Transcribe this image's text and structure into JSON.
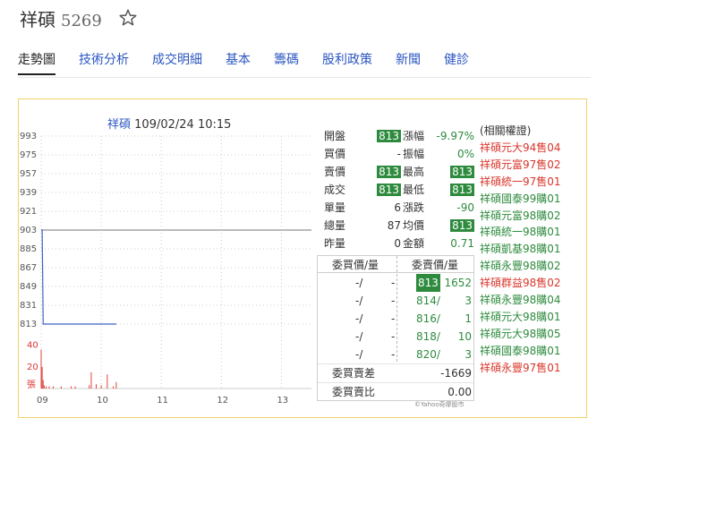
{
  "header": {
    "name": "祥碩",
    "code": "5269",
    "star_icon": "star-outline-icon"
  },
  "tabs": [
    {
      "label": "走勢圖",
      "active": true
    },
    {
      "label": "技術分析",
      "active": false
    },
    {
      "label": "成交明細",
      "active": false
    },
    {
      "label": "基本",
      "active": false
    },
    {
      "label": "籌碼",
      "active": false
    },
    {
      "label": "股利政策",
      "active": false
    },
    {
      "label": "新聞",
      "active": false
    },
    {
      "label": "健診",
      "active": false
    }
  ],
  "chart": {
    "name": "祥碩",
    "datetime": "109/02/24 10:15",
    "colors": {
      "price_line": "#3a62c8",
      "reference_line": "#bbbbbb",
      "volume": "#e0403a",
      "grid": "#cccccc"
    }
  },
  "chart_data": {
    "type": "line",
    "x_ticks": [
      "09",
      "10",
      "11",
      "12",
      "13"
    ],
    "y_ticks": [
      993,
      975,
      957,
      939,
      921,
      903,
      885,
      867,
      849,
      831,
      813
    ],
    "ylim": [
      813,
      993
    ],
    "reference_price": 903,
    "series": [
      {
        "x": [
          "09:00",
          "09:01",
          "09:02",
          "10:15"
        ],
        "values": [
          903,
          903,
          813,
          813
        ]
      }
    ],
    "volume": {
      "ticks": [
        40,
        20
      ],
      "label": "張",
      "bars": [
        {
          "t": "09:00",
          "v": 36
        },
        {
          "t": "09:01",
          "v": 20
        },
        {
          "t": "09:02",
          "v": 8
        },
        {
          "t": "09:03",
          "v": 3
        },
        {
          "t": "09:05",
          "v": 2
        },
        {
          "t": "09:08",
          "v": 2
        },
        {
          "t": "09:12",
          "v": 2
        },
        {
          "t": "09:20",
          "v": 2
        },
        {
          "t": "09:30",
          "v": 2
        },
        {
          "t": "09:34",
          "v": 2
        },
        {
          "t": "09:48",
          "v": 3
        },
        {
          "t": "09:50",
          "v": 15
        },
        {
          "t": "09:55",
          "v": 4
        },
        {
          "t": "10:00",
          "v": 3
        },
        {
          "t": "10:06",
          "v": 13
        },
        {
          "t": "10:12",
          "v": 2
        },
        {
          "t": "10:15",
          "v": 6
        }
      ]
    }
  },
  "quote": {
    "left": [
      {
        "label": "開盤",
        "value": "813",
        "highlight": true
      },
      {
        "label": "買價",
        "value": "-",
        "highlight": false
      },
      {
        "label": "賣價",
        "value": "813",
        "highlight": true
      },
      {
        "label": "成交",
        "value": "813",
        "highlight": true
      },
      {
        "label": "單量",
        "value": "6",
        "highlight": false
      },
      {
        "label": "總量",
        "value": "87",
        "highlight": false
      },
      {
        "label": "昨量",
        "value": "0",
        "highlight": false
      }
    ],
    "right": [
      {
        "label": "漲幅",
        "value": "-9.97%",
        "highlight": false,
        "green": true
      },
      {
        "label": "振幅",
        "value": "0%",
        "highlight": false,
        "green": true
      },
      {
        "label": "最高",
        "value": "813",
        "highlight": true,
        "green": false
      },
      {
        "label": "最低",
        "value": "813",
        "highlight": true,
        "green": false
      },
      {
        "label": "漲跌",
        "value": "-90",
        "highlight": false,
        "green": true
      },
      {
        "label": "均價",
        "value": "813",
        "highlight": true,
        "green": false
      },
      {
        "label": "金額",
        "value": "0.71",
        "highlight": false,
        "green": true
      }
    ]
  },
  "orderbook": {
    "bid_header": "委買價/量",
    "ask_header": "委賣價/量",
    "rows": [
      {
        "bid_price": "-/",
        "bid_qty": "-",
        "ask_price": "813",
        "ask_qty": "1652",
        "ask_highlight": true
      },
      {
        "bid_price": "-/",
        "bid_qty": "-",
        "ask_price": "814/",
        "ask_qty": "3",
        "ask_highlight": false
      },
      {
        "bid_price": "-/",
        "bid_qty": "-",
        "ask_price": "816/",
        "ask_qty": "1",
        "ask_highlight": false
      },
      {
        "bid_price": "-/",
        "bid_qty": "-",
        "ask_price": "818/",
        "ask_qty": "10",
        "ask_highlight": false
      },
      {
        "bid_price": "-/",
        "bid_qty": "-",
        "ask_price": "820/",
        "ask_qty": "3",
        "ask_highlight": false
      }
    ],
    "summary": [
      {
        "label": "委買賣差",
        "value": "-1669"
      },
      {
        "label": "委買賣比",
        "value": "0.00"
      }
    ],
    "credit": "©Yahoo奇摩股市"
  },
  "warrants": {
    "heading": "(相關權證)",
    "items": [
      {
        "label": "祥碩元大94售04",
        "kind": "sell"
      },
      {
        "label": "祥碩元富97售02",
        "kind": "sell"
      },
      {
        "label": "祥碩統一97售01",
        "kind": "sell"
      },
      {
        "label": "祥碩國泰99購01",
        "kind": "buy"
      },
      {
        "label": "祥碩元富98購02",
        "kind": "buy"
      },
      {
        "label": "祥碩統一98購01",
        "kind": "buy"
      },
      {
        "label": "祥碩凱基98購01",
        "kind": "buy"
      },
      {
        "label": "祥碩永豐98購02",
        "kind": "buy"
      },
      {
        "label": "祥碩群益98售02",
        "kind": "sell"
      },
      {
        "label": "祥碩永豐98購04",
        "kind": "buy"
      },
      {
        "label": "祥碩元大98購01",
        "kind": "buy"
      },
      {
        "label": "祥碩元大98購05",
        "kind": "buy"
      },
      {
        "label": "祥碩國泰98購01",
        "kind": "buy"
      },
      {
        "label": "祥碩永豐97售01",
        "kind": "sell"
      }
    ]
  }
}
